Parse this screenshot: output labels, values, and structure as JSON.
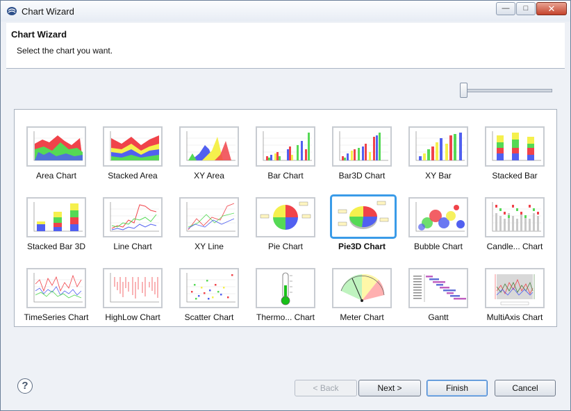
{
  "window": {
    "title": "Chart Wizard"
  },
  "header": {
    "title": "Chart Wizard",
    "subtitle": "Select the chart you want."
  },
  "slider": {
    "value": 0
  },
  "charts": [
    {
      "label": "Area Chart",
      "icon": "area-chart-icon"
    },
    {
      "label": "Stacked Area",
      "icon": "stacked-area-chart-icon"
    },
    {
      "label": "XY Area",
      "icon": "xy-area-chart-icon"
    },
    {
      "label": "Bar Chart",
      "icon": "bar-chart-icon"
    },
    {
      "label": "Bar3D Chart",
      "icon": "bar3d-chart-icon"
    },
    {
      "label": "XY Bar",
      "icon": "xy-bar-chart-icon"
    },
    {
      "label": "Stacked Bar",
      "icon": "stacked-bar-chart-icon"
    },
    {
      "label": "Stacked Bar 3D",
      "icon": "stacked-bar3d-chart-icon"
    },
    {
      "label": "Line Chart",
      "icon": "line-chart-icon"
    },
    {
      "label": "XY Line",
      "icon": "xy-line-chart-icon"
    },
    {
      "label": "Pie Chart",
      "icon": "pie-chart-icon"
    },
    {
      "label": "Pie3D Chart",
      "icon": "pie3d-chart-icon",
      "selected": true
    },
    {
      "label": "Bubble Chart",
      "icon": "bubble-chart-icon"
    },
    {
      "label": "Candle... Chart",
      "icon": "candlestick-chart-icon"
    },
    {
      "label": "TimeSeries Chart",
      "icon": "timeseries-chart-icon"
    },
    {
      "label": "HighLow Chart",
      "icon": "highlow-chart-icon"
    },
    {
      "label": "Scatter Chart",
      "icon": "scatter-chart-icon"
    },
    {
      "label": "Thermo... Chart",
      "icon": "thermometer-chart-icon"
    },
    {
      "label": "Meter Chart",
      "icon": "meter-chart-icon"
    },
    {
      "label": "Gantt",
      "icon": "gantt-chart-icon"
    },
    {
      "label": "MultiAxis Chart",
      "icon": "multiaxis-chart-icon"
    }
  ],
  "buttons": {
    "back": "< Back",
    "next": "Next >",
    "finish": "Finish",
    "cancel": "Cancel"
  },
  "help": {
    "glyph": "?"
  },
  "colors": {
    "selection": "#3a9be8",
    "red": "#f0434a",
    "green": "#55d955",
    "blue": "#5160f0",
    "yellow": "#f5f04d"
  }
}
